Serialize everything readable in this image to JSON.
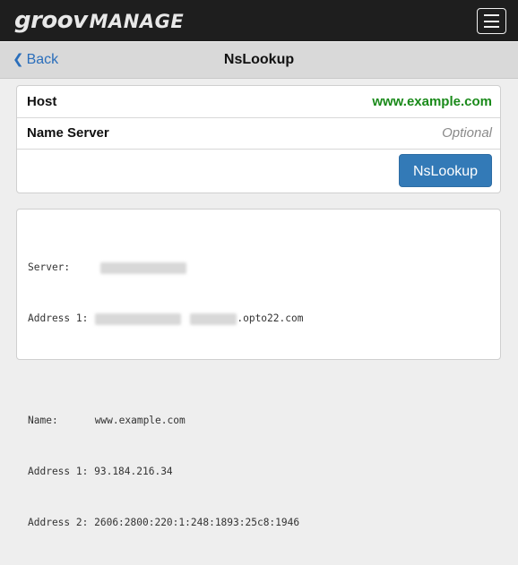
{
  "header": {
    "logo_groov": "groov",
    "logo_manage": "MANAGE",
    "menu_icon": "hamburger-menu-icon"
  },
  "navbar": {
    "back_label": "Back",
    "back_icon": "chevron-left-icon",
    "title": "NsLookup"
  },
  "form": {
    "host_label": "Host",
    "host_value": "www.example.com",
    "nameserver_label": "Name Server",
    "nameserver_placeholder": "Optional",
    "button_label": "NsLookup"
  },
  "output": {
    "server_label": "Server:",
    "address1_label": "Address 1:",
    "address1_suffix": ".opto22.com",
    "name_label": "Name:",
    "name_value": "www.example.com",
    "result_address1_label": "Address 1:",
    "result_address1_value": "93.184.216.34",
    "result_address2_label": "Address 2:",
    "result_address2_value": "2606:2800:220:1:248:1893:25c8:1946"
  },
  "colors": {
    "topbar": "#1e1e1e",
    "accent_link": "#2a6ebb",
    "button": "#337ab7",
    "host_value": "#1a8a1a"
  }
}
